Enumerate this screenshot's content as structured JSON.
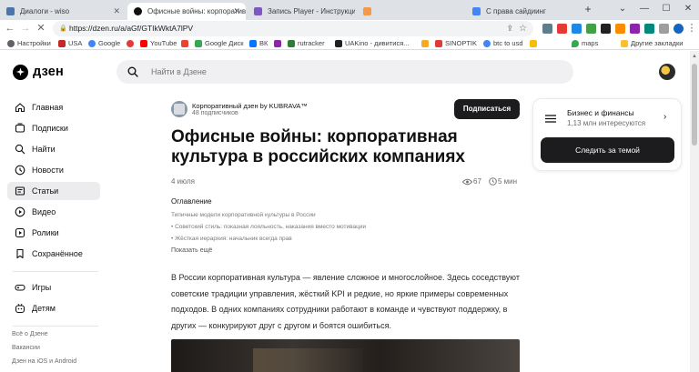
{
  "browser": {
    "tabs": [
      {
        "label": "Диалоги - wiso",
        "fav_color": "#4a76a8",
        "active": false
      },
      {
        "label": "Офисные войны: корпоратив",
        "fav_color": "#111111",
        "active": true
      },
      {
        "label": "Запись Player - Инструкции",
        "fav_color": "#7e57c2",
        "active": false
      },
      {
        "label": "",
        "fav_color": "#f2994a",
        "active": false
      },
      {
        "label": "С права сайдиинг",
        "fav_color": "#4285f4",
        "active": false
      }
    ],
    "new_tab": "+",
    "window_controls": [
      "⌄",
      "—",
      "☐",
      "✕"
    ],
    "url": "https://dzen.ru/a/aGf/GTIkWktA7lPV",
    "bookmarks": [
      {
        "label": "Настройки",
        "color": "#5f6368"
      },
      {
        "label": "USA",
        "color": "#c62828"
      },
      {
        "label": "Google",
        "color": "#4285f4"
      },
      {
        "label": "",
        "color": "#e53935"
      },
      {
        "label": "YouTube",
        "color": "#ff0000"
      },
      {
        "label": "",
        "color": "#ea4335"
      },
      {
        "label": "Google Диск",
        "color": "#34a853"
      },
      {
        "label": "ВК",
        "color": "#0077ff"
      },
      {
        "label": "",
        "color": "#8e24aa"
      },
      {
        "label": "rutracker",
        "color": "#2e7d32"
      },
      {
        "label": "UAKino - дивитися...",
        "color": "#212121"
      },
      {
        "label": "",
        "color": "#f9a825"
      },
      {
        "label": "SINOPTIK",
        "color": "#e53935"
      },
      {
        "label": "btc to usd",
        "color": "#4285f4"
      },
      {
        "label": "",
        "color": "#fbbc04"
      },
      {
        "label": "maps",
        "color": "#34a853"
      },
      {
        "label": "Другие закладки",
        "color": "#fbc02d"
      }
    ]
  },
  "header": {
    "logo_text": "дзен",
    "search_placeholder": "Найти в Дзене"
  },
  "sidebar": {
    "items": [
      {
        "label": "Главная",
        "icon": "home-icon",
        "active": false
      },
      {
        "label": "Подписки",
        "icon": "subscriptions-icon",
        "active": false
      },
      {
        "label": "Найти",
        "icon": "search-icon",
        "active": false
      },
      {
        "label": "Новости",
        "icon": "news-icon",
        "active": false
      },
      {
        "label": "Статьи",
        "icon": "articles-icon",
        "active": true
      },
      {
        "label": "Видео",
        "icon": "video-icon",
        "active": false
      },
      {
        "label": "Ролики",
        "icon": "shorts-icon",
        "active": false
      },
      {
        "label": "Сохранённое",
        "icon": "bookmark-icon",
        "active": false
      }
    ],
    "items2": [
      {
        "label": "Игры",
        "icon": "gamepad-icon"
      },
      {
        "label": "Детям",
        "icon": "kids-icon"
      }
    ],
    "footer": [
      "Всё о Дзене",
      "Вакансии",
      "Дзен на iOS и Android"
    ]
  },
  "article": {
    "channel_name": "Корпоративный дзен by KUBRAVA™",
    "channel_subs": "48 подписчиков",
    "subscribe_label": "Подписаться",
    "title": "Офисные войны: корпоративная культура в российских компаниях",
    "date": "4 июля",
    "views": "67",
    "read_time": "5 мин",
    "toc_heading": "Оглавление",
    "toc": [
      "Типичные модели корпоративной культуры в России",
      "• Советский стиль: показная лояльность, наказания вместо мотивации",
      "• Жёсткая иерархия: начальник всегда прав"
    ],
    "toc_more": "Показать ещё",
    "body": "В России корпоративная культура — явление сложное и многослойное. Здесь соседствуют советские традиции управления, жёсткий KPI и редкие, но яркие примеры современных подходов. В одних компаниях сотрудники работают в команде и чувствуют поддержку, в других — конкурируют друг с другом и боятся ошибиться."
  },
  "topic_card": {
    "name": "Бизнес и финансы",
    "count": "1,13 млн интересуются",
    "follow_label": "Следить за темой"
  }
}
